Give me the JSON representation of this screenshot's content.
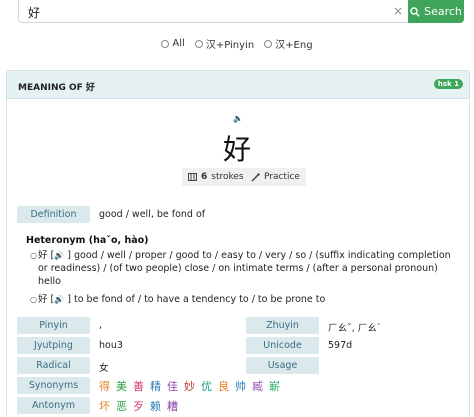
{
  "search": {
    "value": "好",
    "clear_icon": "×",
    "button_label": "Search",
    "options": [
      "All",
      "汉+Pinyin",
      "汉+Eng"
    ]
  },
  "card": {
    "title": "MEANING OF 好",
    "badge": "hsk 1",
    "character": "好",
    "strokes_count": "6",
    "strokes_label": "strokes",
    "practice_label": "Practice",
    "definition_label": "Definition",
    "definition_value": "good / well, be fond of",
    "heteronym_title": "Heteronym (haˇo, hào)",
    "heteronyms": [
      {
        "char": "好",
        "text_line1": "] good / well / proper / good to / easy to / very / so / (suffix indicating completion",
        "text_line2": "or readiness) / (of two people) close / on intimate terms / (after a personal pronoun)",
        "text_line3": "hello"
      },
      {
        "char": "好",
        "text_line1": "] to be fond of / to have a tendency to / to be prone to"
      }
    ],
    "details": {
      "pinyin_label": "Pinyin",
      "pinyin_value": ",",
      "zhuyin_label": "Zhuyin",
      "zhuyin_value": "ㄏㄠˇ, ㄏㄠˋ",
      "jyutping_label": "Jyutping",
      "jyutping_value": "hou3",
      "unicode_label": "Unicode",
      "unicode_value": "597d",
      "radical_label": "Radical",
      "radical_value": "女",
      "usage_label": "Usage",
      "synonyms_label": "Synonyms",
      "synonyms": [
        "得",
        "美",
        "善",
        "精",
        "佳",
        "妙",
        "优",
        "良",
        "帅",
        "臧",
        "嶄"
      ],
      "antonym_label": "Antonym",
      "antonyms": [
        "坏",
        "恶",
        "歹",
        "赖",
        "糟"
      ]
    }
  },
  "colors": {
    "accent_green": "#3fa55a",
    "label_bg": "#dbe9ed",
    "label_text": "#3a6f82",
    "header_bg": "#e5f1f3",
    "char_palette": [
      "#e0862a",
      "#2f9e44",
      "#d6336c",
      "#2b7bb9",
      "#8e44ad",
      "#c0392b",
      "#16a085",
      "#e67e22",
      "#2980b9",
      "#9b59b6",
      "#27ae60"
    ]
  },
  "icons": {
    "speaker": "speaker-icon",
    "search": "search-icon",
    "strokes": "strokes-icon",
    "practice": "brush-icon"
  }
}
